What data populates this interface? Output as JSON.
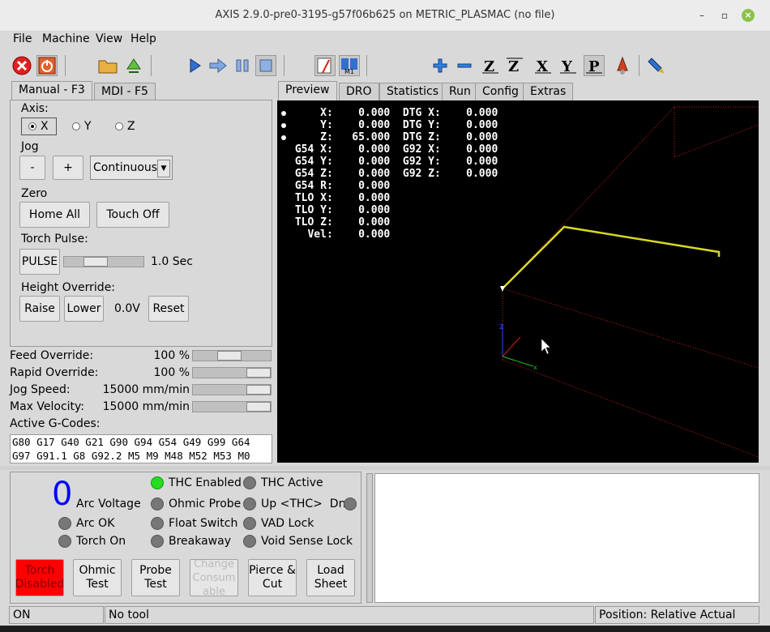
{
  "window": {
    "title": "AXIS 2.9.0-pre0-3195-g57f06b625 on METRIC_PLASMAC (no file)"
  },
  "menu": {
    "items": [
      "File",
      "Machine",
      "View",
      "Help"
    ]
  },
  "tabs_left": {
    "manual": "Manual - F3",
    "mdi": "MDI - F5"
  },
  "tabs_right": [
    "Preview",
    "DRO",
    "Statistics",
    "Run",
    "Config",
    "Extras"
  ],
  "manual": {
    "axis_label": "Axis:",
    "axes": [
      "X",
      "Y",
      "Z"
    ],
    "selected_axis": "X",
    "jog_label": "Jog",
    "jog_minus": "-",
    "jog_plus": "+",
    "jog_mode": "Continuous",
    "zero_label": "Zero",
    "home_all": "Home All",
    "touch_off": "Touch Off",
    "torch_pulse_label": "Torch Pulse:",
    "pulse_button": "PULSE",
    "pulse_time": "1.0 Sec",
    "height_override_label": "Height Override:",
    "raise": "Raise",
    "lower": "Lower",
    "height_value": "0.0V",
    "reset": "Reset"
  },
  "overrides": [
    {
      "label": "Feed Override:",
      "value": "100 %",
      "level": 0.45
    },
    {
      "label": "Rapid Override:",
      "value": "100 %",
      "level": 1.0
    },
    {
      "label": "Jog Speed:",
      "value": "15000 mm/min",
      "level": 1.0
    },
    {
      "label": "Max Velocity:",
      "value": "15000 mm/min",
      "level": 1.0
    }
  ],
  "gcodes": {
    "label": "Active G-Codes:",
    "line1": "G80 G17 G40 G21 G90 G94 G54 G49 G99 G64",
    "line2": "G97 G91.1 G8 G92.2 M5 M9 M48 M52 M53 M0"
  },
  "dro": {
    "rows": [
      "     X:    0.000  DTG X:    0.000",
      "     Y:    0.000  DTG Y:    0.000",
      "     Z:   65.000  DTG Z:    0.000",
      " G54 X:    0.000  G92 X:    0.000",
      " G54 Y:    0.000  G92 Y:    0.000",
      " G54 Z:    0.000  G92 Z:    0.000",
      " G54 R:    0.000",
      " TLO X:    0.000",
      " TLO Y:    0.000",
      " TLO Z:    0.000",
      "   Vel:    0.000"
    ]
  },
  "plasma": {
    "arc_voltage_value": "0",
    "arc_voltage_label": "Arc Voltage",
    "arc_ok": "Arc OK",
    "torch_on": "Torch On",
    "thc_enabled": "THC Enabled",
    "ohmic_probe": "Ohmic Probe",
    "float_switch": "Float Switch",
    "breakaway": "Breakaway",
    "thc_active": "THC Active",
    "up_thc_dn": "Up <THC>  Dn",
    "vad_lock": "VAD Lock",
    "void_sense_lock": "Void Sense Lock",
    "buttons": {
      "torch": "Torch Disabled",
      "ohmic": "Ohmic Test",
      "probe": "Probe Test",
      "change": "Change Consumable",
      "pierce": "Pierce & Cut",
      "load": "Load Sheet"
    },
    "colors": {
      "led_on": "#22dd22",
      "led_off": "#777777",
      "torch_disabled": "#ff0000",
      "arc_value": "#0000ff"
    }
  },
  "status": {
    "state": "ON",
    "tool": "No tool",
    "position": "Position: Relative Actual"
  }
}
